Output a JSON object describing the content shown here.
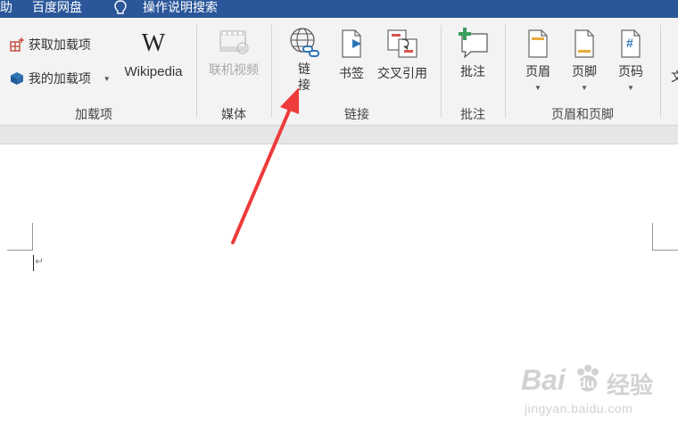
{
  "topbar": {
    "items": [
      "助",
      "百度网盘",
      "操作说明搜索"
    ]
  },
  "ribbon": {
    "groups": {
      "addins": {
        "label": "加载项",
        "get_addins": "获取加载项",
        "my_addins": "我的加载项",
        "wikipedia": "Wikipedia",
        "wikipedia_logo": "W"
      },
      "media": {
        "label": "媒体",
        "online_video": "联机视频"
      },
      "links": {
        "label": "链接",
        "link_line1": "链",
        "link_line2": "接",
        "bookmark": "书签",
        "cross_reference": "交叉引用"
      },
      "comments": {
        "label": "批注",
        "comment": "批注"
      },
      "header_footer": {
        "label": "页眉和页脚",
        "header": "页眉",
        "footer": "页脚",
        "page_number": "页码",
        "page_number_glyph": "#"
      },
      "text": {
        "cut_label": "文"
      }
    }
  },
  "document": {
    "paragraph_mark": "↵"
  },
  "watermark": {
    "brand": "Bai",
    "brand_du": "du",
    "brand_cn": "经验",
    "url": "jingyan.baidu.com"
  },
  "colors": {
    "title_bar": "#2b579a",
    "ribbon_bg": "#f3f3f3",
    "annotation_arrow": "#ee3b3b"
  }
}
